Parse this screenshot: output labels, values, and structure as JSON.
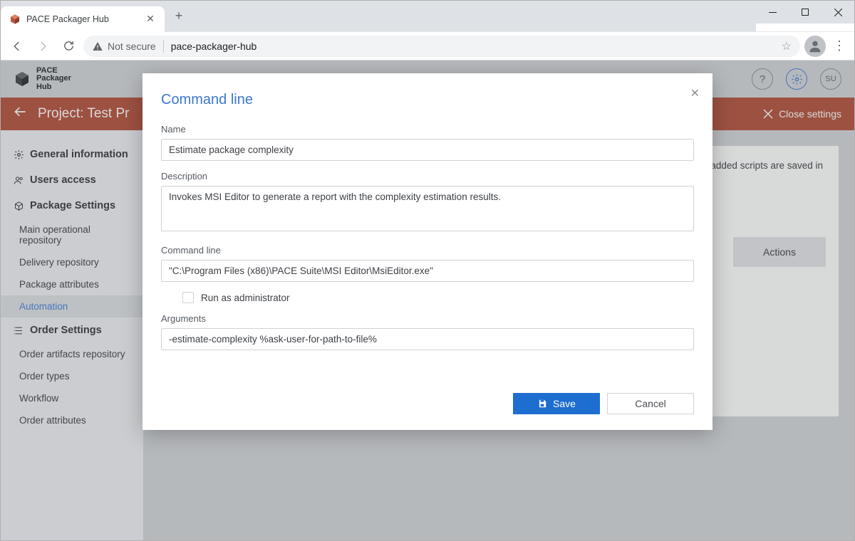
{
  "browser": {
    "tab_title": "PACE Packager Hub",
    "not_secure": "Not secure",
    "url": "pace-packager-hub"
  },
  "app": {
    "logo_line1": "PACE",
    "logo_line2": "Packager",
    "logo_line3": "Hub",
    "user_initials": "SU"
  },
  "banner": {
    "title": "Project: Test Pr",
    "close": "Close settings"
  },
  "sidebar": {
    "general": "General information",
    "users": "Users access",
    "package_settings": "Package Settings",
    "pkg_items": [
      "Main operational repository",
      "Delivery repository",
      "Package attributes",
      "Automation"
    ],
    "order_settings": "Order Settings",
    "order_items": [
      "Order artifacts repository",
      "Order types",
      "Workflow",
      "Order attributes"
    ]
  },
  "content": {
    "hint_fragment": "e added scripts are saved in",
    "actions": "Actions"
  },
  "modal": {
    "title": "Command line",
    "labels": {
      "name": "Name",
      "description": "Description",
      "command_line": "Command line",
      "run_as_admin": "Run as administrator",
      "arguments": "Arguments"
    },
    "values": {
      "name": "Estimate package complexity",
      "description": "Invokes MSI Editor to generate a report with the complexity estimation results.",
      "command_line": "\"C:\\Program Files (x86)\\PACE Suite\\MSI Editor\\MsiEditor.exe\"",
      "run_as_admin": false,
      "arguments": "-estimate-complexity %ask-user-for-path-to-file%"
    },
    "buttons": {
      "save": "Save",
      "cancel": "Cancel"
    }
  }
}
